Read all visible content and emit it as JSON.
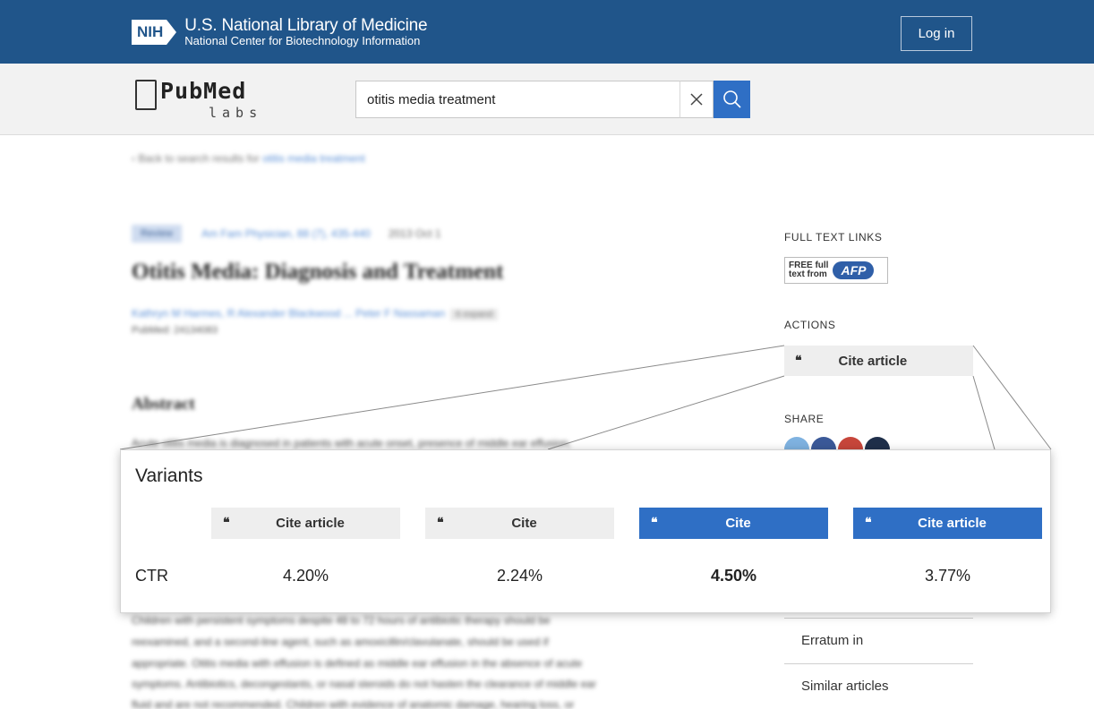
{
  "header": {
    "nih_logo": "NIH",
    "org_title": "U.S. National Library of Medicine",
    "org_subtitle": "National Center for Biotechnology Information",
    "login_label": "Log in",
    "brand_color": "#20558a"
  },
  "search": {
    "logo_main": "PubMed",
    "logo_sub": "labs",
    "query": "otitis media treatment",
    "accent_color": "#2f6fc5"
  },
  "article": {
    "back_prefix": "‹  Back to search results for ",
    "back_query": "otitis media treatment",
    "badge": "Review",
    "journal": "Am Fam Physician, 88 (7), 435-440",
    "date": "2013 Oct 1",
    "title": "Otitis Media: Diagnosis and Treatment",
    "authors": "Kathryn M Harmes, R Alexander Blackwood ... Peter F Nassaman",
    "authors_expand": "6 expand",
    "pubmed_id": "PubMed: 24134083",
    "abstract_heading": "Abstract",
    "abstract_lines": [
      "Acute otitis media is diagnosed in patients with acute onset, presence of middle ear effusion,",
      "Children with persistent symptoms despite 48 to 72 hours of antibiotic therapy should be",
      "reexamined, and a second-line agent, such as amoxicillin/clavulanate, should be used if",
      "appropriate. Otitis media with effusion is defined as middle ear effusion in the absence of acute",
      "symptoms. Antibiotics, decongestants, or nasal steroids do not hasten the clearance of middle ear",
      "fluid and are not recommended. Children with evidence of anatomic damage, hearing loss, or"
    ]
  },
  "sidebar": {
    "full_text_label": "FULL TEXT LINKS",
    "free_line1": "FREE full",
    "free_line2": "text from",
    "afp": "AFP",
    "actions_label": "ACTIONS",
    "cite_label": "Cite article",
    "share_label": "SHARE",
    "links": [
      "Erratum in",
      "Similar articles"
    ]
  },
  "variants": {
    "title": "Variants",
    "metric_label": "CTR",
    "items": [
      {
        "label": "Cite article",
        "style": "gray",
        "ctr": "4.20%",
        "best": false
      },
      {
        "label": "Cite",
        "style": "gray",
        "ctr": "2.24%",
        "best": false
      },
      {
        "label": "Cite",
        "style": "blue",
        "ctr": "4.50%",
        "best": true
      },
      {
        "label": "Cite article",
        "style": "blue",
        "ctr": "3.77%",
        "best": false
      }
    ]
  }
}
